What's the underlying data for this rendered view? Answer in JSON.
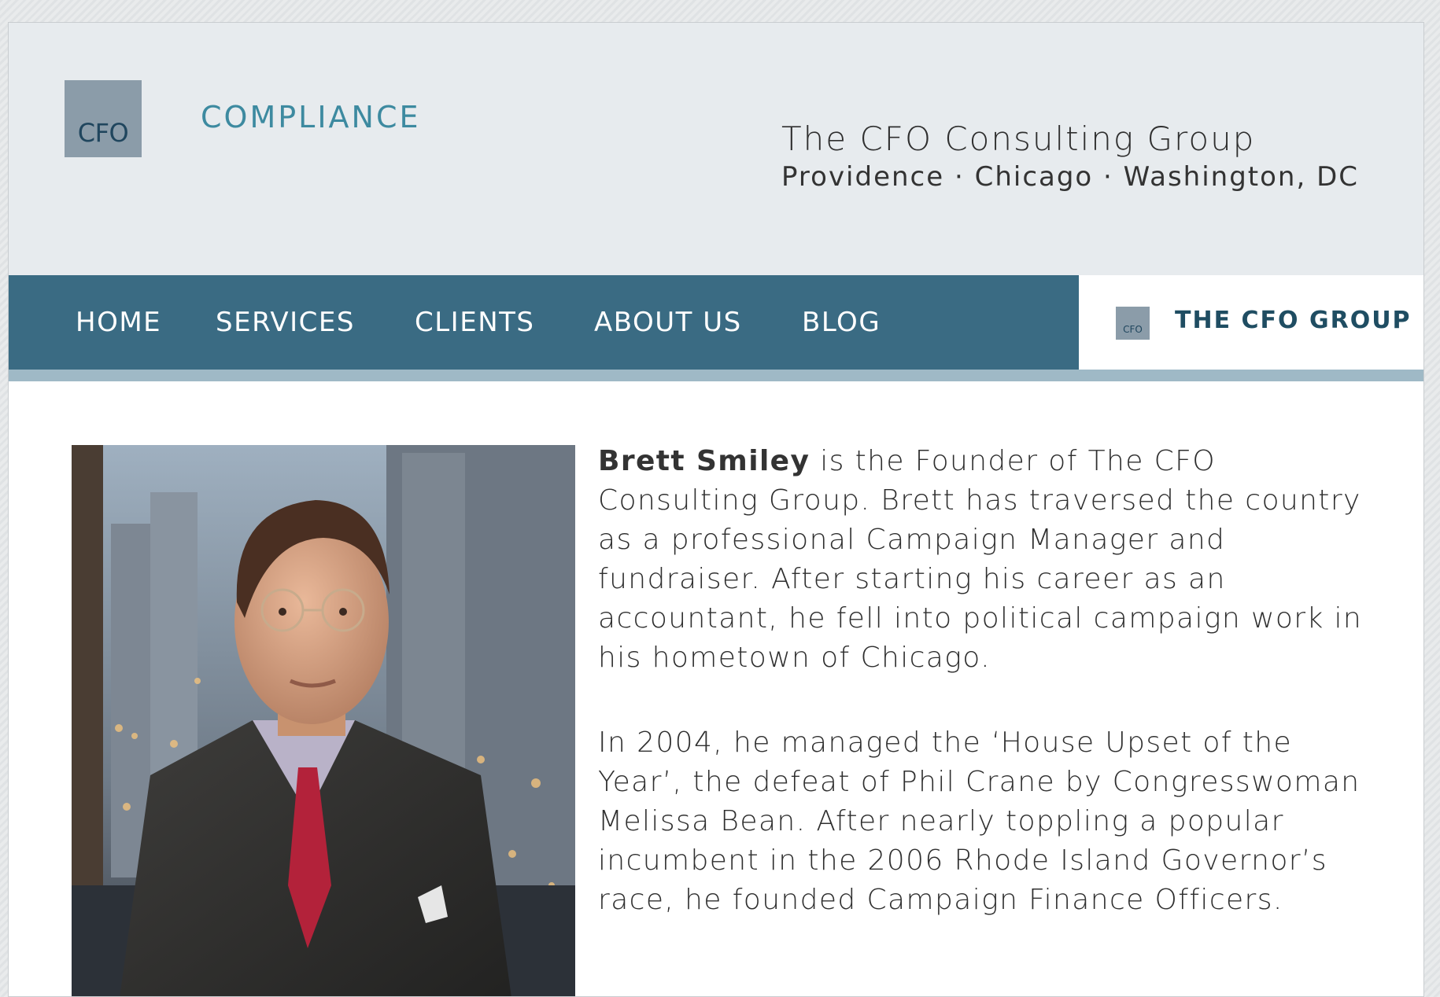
{
  "header": {
    "logo_text": "CFO",
    "brand_word": "COMPLIANCE",
    "company_name": "The CFO Consulting Group",
    "locations": "Providence · Chicago · Washington, DC"
  },
  "nav": {
    "items": [
      {
        "label": "HOME"
      },
      {
        "label": "SERVICES"
      },
      {
        "label": "CLIENTS"
      },
      {
        "label": "ABOUT US"
      },
      {
        "label": "BLOG"
      }
    ],
    "right_logo_text": "CFO",
    "right_brand": "THE CFO GROUP"
  },
  "colors": {
    "nav_background": "#3a6b83",
    "nav_stripe": "#9fb9c6",
    "brand_teal": "#3d8aa0",
    "header_background": "#e7ebee"
  },
  "content": {
    "bio_name": "Brett Smiley",
    "bio_paragraph_1_rest": " is the Founder of The CFO Consulting Group. Brett has traversed the country as a professional Campaign Manager and fundraiser. After starting his career as an accountant, he fell into political campaign work in his hometown of Chicago.",
    "bio_paragraph_2": "In 2004, he managed the ‘House Upset of the Year’, the defeat of Phil Crane by Congresswoman Melissa Bean. After nearly toppling a popular incumbent in the 2006 Rhode Island Governor’s race, he founded Campaign Finance Officers."
  }
}
